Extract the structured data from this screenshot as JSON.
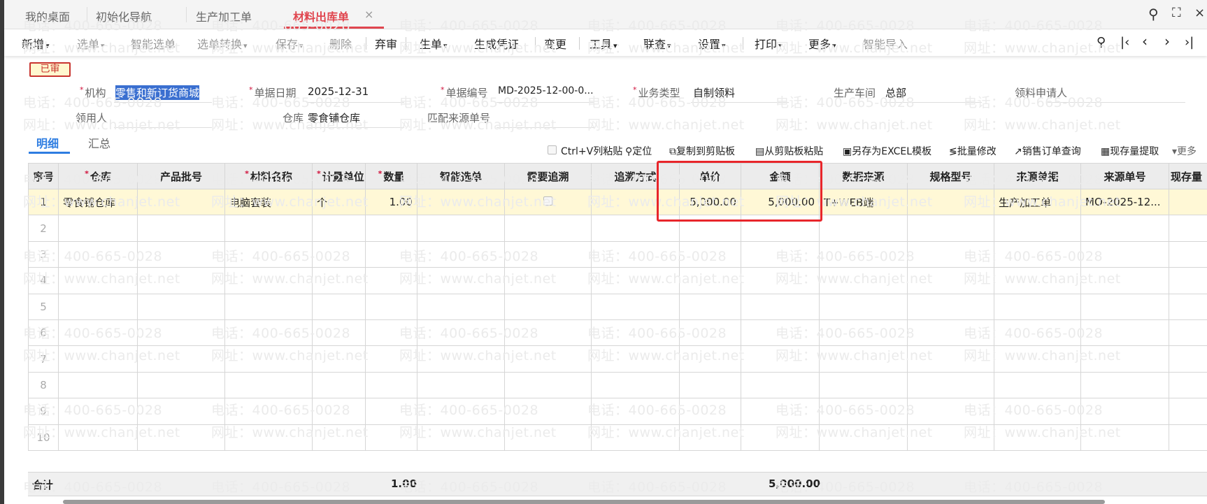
{
  "tabs": [
    {
      "label": "我的桌面"
    },
    {
      "label": "初始化导航"
    },
    {
      "label": "生产加工单"
    },
    {
      "label": "材料出库单",
      "active": true
    }
  ],
  "tab_close": "×",
  "toolbar": [
    "新增",
    "选单",
    "智能选单",
    "选单转换",
    "保存",
    "删除",
    "弃审",
    "生单",
    "生成凭证",
    "变更",
    "工具",
    "联查",
    "设置",
    "打印",
    "更多",
    "智能导入"
  ],
  "status_badge": "已审",
  "form": {
    "org_label": "机构",
    "org_value": "零售和新订货商城",
    "date_label": "单据日期",
    "date_value": "2025-12-31",
    "code_label": "单据编号",
    "code_value": "MD-2025-12-00-0...",
    "biz_label": "业务类型",
    "biz_value": "自制领料",
    "workshop_label": "生产车间",
    "workshop_value": "总部",
    "applicant_label": "领料申请人",
    "receiver_label": "领用人",
    "warehouse_label": "仓库",
    "warehouse_value": "零食铺仓库",
    "match_label": "匹配来源单号"
  },
  "grid_tabs": [
    "明细",
    "汇总"
  ],
  "grid_tools": [
    "Ctrl+V列粘贴",
    "定位",
    "复制到剪贴板",
    "从剪贴板粘贴",
    "另存为EXCEL模板",
    "批量修改",
    "销售订单查询",
    "现存量提取",
    "更多"
  ],
  "columns": [
    "序号",
    "仓库",
    "产品批号",
    "材料名称",
    "计量单位",
    "数量",
    "智能选单",
    "需要追溯",
    "追溯方式",
    "单价",
    "金额",
    "数据来源",
    "规格型号",
    "来源单据",
    "来源单号",
    "现存量"
  ],
  "rows": [
    {
      "idx": "1",
      "warehouse": "零食铺仓库",
      "batch": "",
      "material": "电脑套装",
      "unit": "个",
      "qty": "1.00",
      "smart": "",
      "trace": false,
      "trace_mode": "",
      "price": "5,000.00",
      "amount": "5,000.00",
      "source": "T+WEB端",
      "spec": "",
      "src_doc": "生产加工单",
      "src_no": "MO-2025-12..."
    },
    {
      "idx": "2"
    },
    {
      "idx": "3"
    },
    {
      "idx": "4"
    },
    {
      "idx": "5"
    },
    {
      "idx": "6"
    },
    {
      "idx": "7"
    },
    {
      "idx": "8"
    },
    {
      "idx": "9"
    },
    {
      "idx": "10"
    }
  ],
  "totals": {
    "label": "合计",
    "qty": "1.00",
    "amount": "5,000.00"
  },
  "watermark": {
    "phone": "电话：400-665-0028",
    "site": "网址：www.chanjet.net"
  },
  "colors": {
    "accent": "#e0464f",
    "highlight_box": "#e8262b",
    "selected_row": "#fff8d6"
  }
}
